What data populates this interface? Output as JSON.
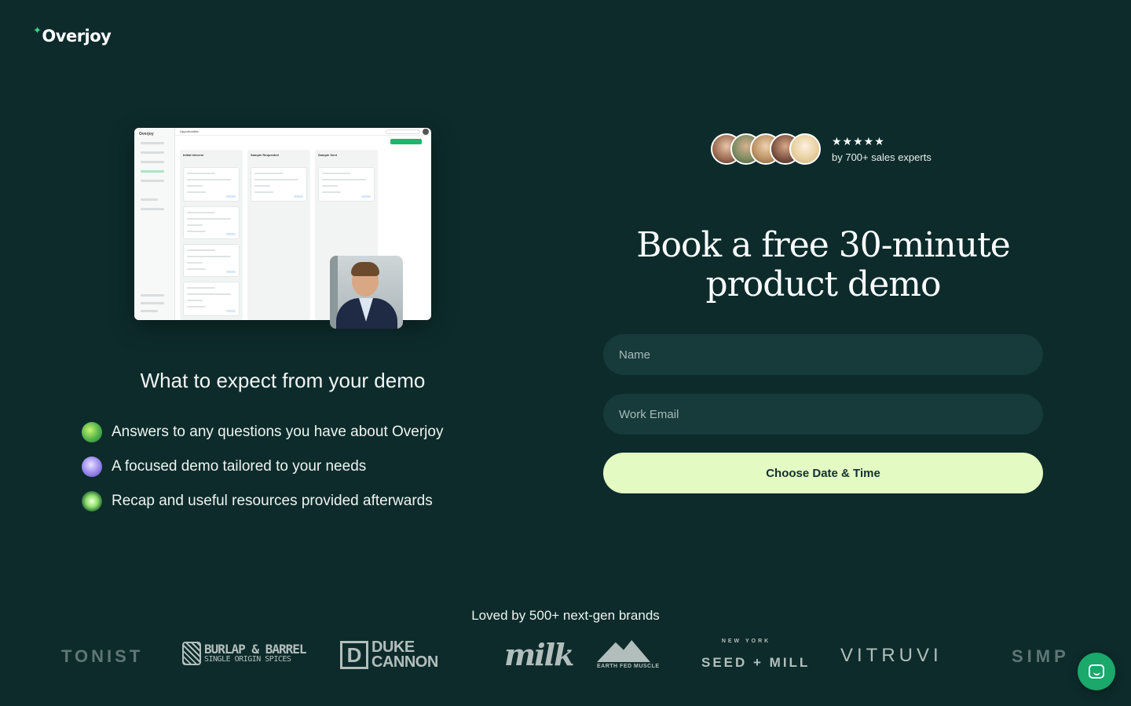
{
  "brand": {
    "name": "Overjoy"
  },
  "preview": {
    "app_brand": "Overjoy",
    "breadcrumb": "Opportunities",
    "columns": [
      {
        "title": "Initial Interest"
      },
      {
        "title": "Sample Requested"
      },
      {
        "title": "Sample Sent"
      }
    ]
  },
  "expect": {
    "title": "What to expect from your demo",
    "items": [
      {
        "text": "Answers to any questions you have about Overjoy",
        "icon": "green-sphere-icon"
      },
      {
        "text": "A focused demo tailored to your needs",
        "icon": "purple-gem-icon"
      },
      {
        "text": "Recap and useful resources provided afterwards",
        "icon": "green-burst-icon"
      }
    ]
  },
  "social_proof": {
    "stars": "★★★★★",
    "text": "by 700+ sales experts"
  },
  "form": {
    "headline_line1": "Book a free 30-minute",
    "headline_line2": "product demo",
    "name_placeholder": "Name",
    "email_placeholder": "Work Email",
    "cta_label": "Choose Date & Time"
  },
  "brands": {
    "title": "Loved by 500+ next-gen brands",
    "logos": [
      "TONIST",
      "BURLAP & BARREL",
      "SINGLE ORIGIN SPICES",
      "DUKE",
      "CANNON",
      "milk",
      "EARTH FED MUSCLE",
      "NEW YORK",
      "SEED + MILL",
      "VITRUVI",
      "SIMP"
    ]
  },
  "colors": {
    "background": "#0d2b2b",
    "accent": "#e3fbc2",
    "field": "#173a3a",
    "chat": "#1aa86b"
  }
}
